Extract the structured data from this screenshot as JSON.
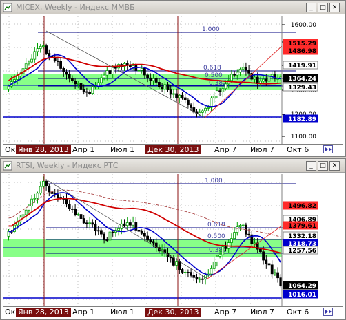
{
  "windows": [
    {
      "title": "MICEX, Weekly - Индекс ММВБ",
      "buttons": {
        "minimize": "_",
        "maximize": "□",
        "close": "✕"
      },
      "price_axis": {
        "ticks": [
          "1600.00",
          "1500.00",
          "1400.00",
          "1300.00",
          "1200.00",
          "1100.00"
        ],
        "markers": [
          {
            "text": "1515.29",
            "bg": "#ff2a2a",
            "fg": "#000"
          },
          {
            "text": "1486.98",
            "bg": "#ff2a2a",
            "fg": "#000"
          },
          {
            "text": "1419.91",
            "bg": "#ffffff",
            "fg": "#000"
          },
          {
            "text": "1364.24",
            "bg": "#000000",
            "fg": "#ffffff"
          },
          {
            "text": "1329.43",
            "bg": "#ffffff",
            "fg": "#000"
          },
          {
            "text": "1182.89",
            "bg": "#0000cc",
            "fg": "#ffffff"
          }
        ]
      },
      "fib_labels": [
        "1.000",
        "0.618",
        "0.500",
        "0.382"
      ],
      "x_axis": {
        "labels": [
          "Ок",
          "Янв 28, 2013",
          "Апр 1",
          "Июл 1",
          "Дек 30, 2013",
          "Апр 7",
          "Июл 7",
          "Окт 6"
        ],
        "highlighted": [
          "Янв 28, 2013",
          "Дек 30, 2013"
        ]
      },
      "scroll_icon": "scroll-end-icon"
    },
    {
      "title": "RTSI, Weekly - Индекс РТС",
      "buttons": {
        "minimize": "_",
        "maximize": "□",
        "close": "✕"
      },
      "price_axis": {
        "markers": [
          {
            "text": "1496.82",
            "bg": "#ff2a2a",
            "fg": "#000"
          },
          {
            "text": "1406.89",
            "bg": "#ffffff",
            "fg": "#000"
          },
          {
            "text": "1379.61",
            "bg": "#ff2a2a",
            "fg": "#000"
          },
          {
            "text": "1332.18",
            "bg": "#ffffff",
            "fg": "#000"
          },
          {
            "text": "1318.73",
            "bg": "#0000cc",
            "fg": "#ffffff"
          },
          {
            "text": "1257.56",
            "bg": "#ffffff",
            "fg": "#000"
          },
          {
            "text": "1064.29",
            "bg": "#000000",
            "fg": "#ffffff"
          },
          {
            "text": "1016.01",
            "bg": "#0000cc",
            "fg": "#ffffff"
          }
        ]
      },
      "fib_labels": [
        "1.000",
        "0.618",
        "0.500",
        "0.382"
      ],
      "x_axis": {
        "labels": [
          "Ок",
          "Янв 28, 2013",
          "Апр 1",
          "Июл 1",
          "Дек 30, 2013",
          "Апр 7",
          "Июл 7",
          "Окт 6"
        ],
        "highlighted": [
          "Янв 28, 2013",
          "Дек 30, 2013"
        ]
      },
      "scroll_icon": "scroll-end-icon"
    }
  ],
  "colors": {
    "up_candle": "#00a000",
    "down_candle": "#000000",
    "zone": "#88ff88",
    "ma_red": "#d00000",
    "ma_blue": "#0000cc",
    "fib": "#000080",
    "vline": "#8b1010"
  }
}
